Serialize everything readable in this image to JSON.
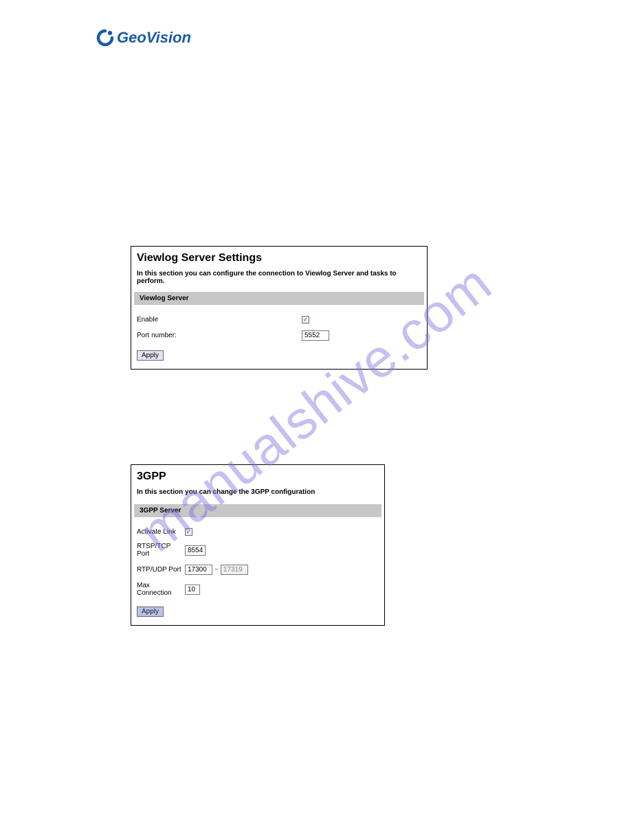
{
  "brand": {
    "geo": "Geo",
    "vision": "Vision"
  },
  "watermark": "manualshive.com",
  "panel1": {
    "title": "Viewlog Server Settings",
    "desc": "In this section you can configure the connection to Viewlog Server and tasks to perform.",
    "section": "Viewlog Server",
    "enable_label": "Enable",
    "port_label": "Port number:",
    "port_value": "5552",
    "apply": "Apply"
  },
  "panel2": {
    "title": "3GPP",
    "desc": "In this section you can change the 3GPP configuration",
    "section": "3GPP Server",
    "activate_label": "Activate Link",
    "rtsp_label": "RTSP/TCP Port",
    "rtsp_value": "8554",
    "rtp_label": "RTP/UDP Port",
    "rtp_from": "17300",
    "rtp_to": "17319",
    "max_label": "Max Connection",
    "max_value": "10",
    "apply": "Apply"
  }
}
